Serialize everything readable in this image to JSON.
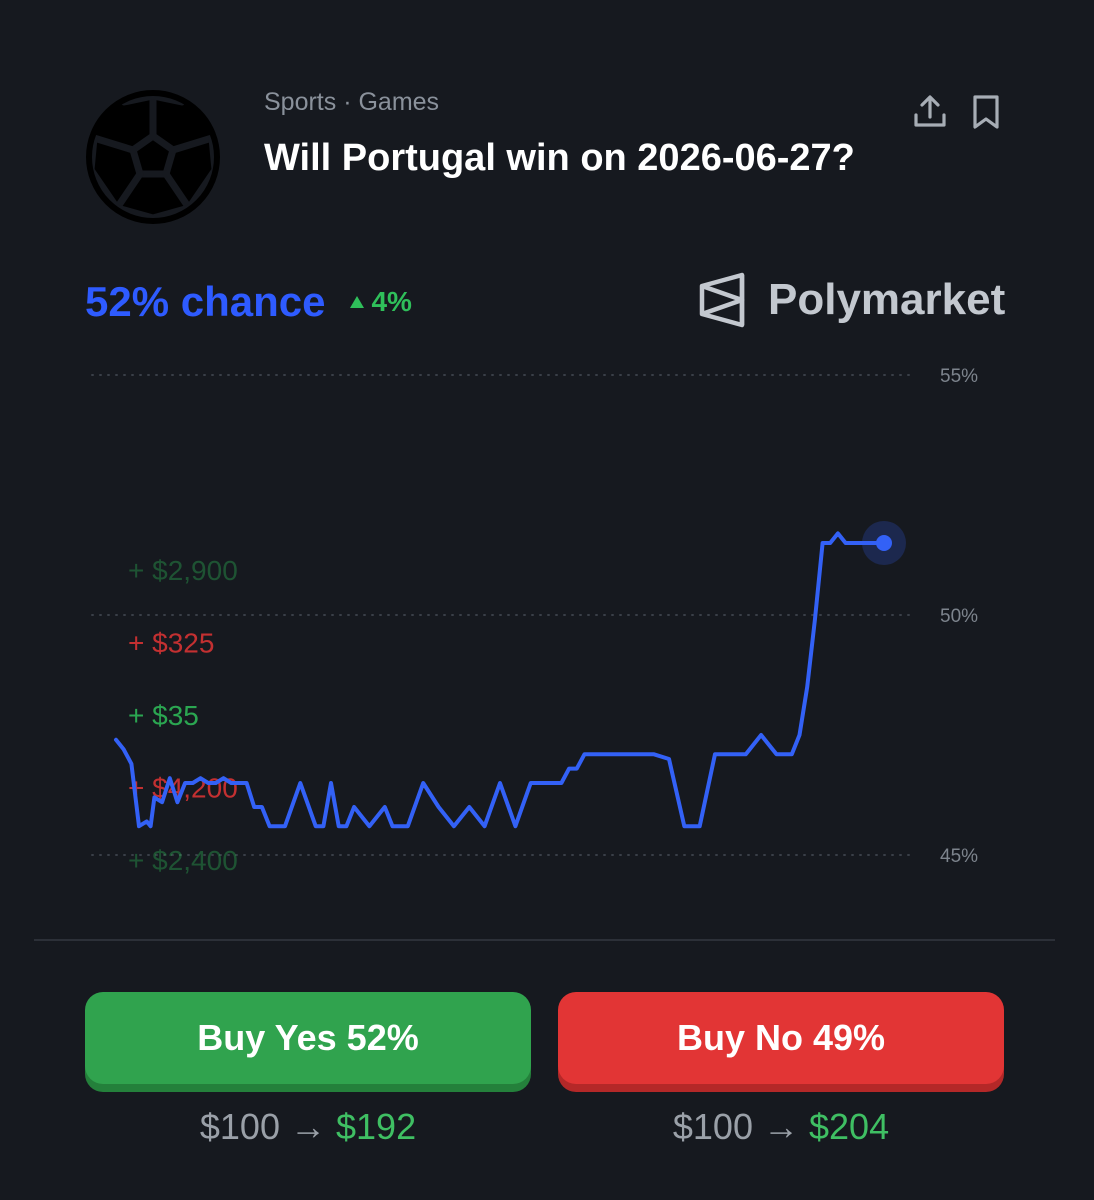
{
  "market": {
    "category": "Sports · Games",
    "question": "Will Portugal win on 2026-06-27?",
    "icon": "soccer-ball-icon",
    "actions": {
      "share_icon": "share-icon",
      "bookmark_icon": "bookmark-icon"
    }
  },
  "odds": {
    "chance_label": "52% chance",
    "change_label": "4%",
    "change_direction": "up",
    "chance_color": "#2e5bff",
    "change_color": "#2fbf5a"
  },
  "brand": {
    "name": "Polymarket",
    "logo": "polymarket-logo-icon"
  },
  "chart_data": {
    "type": "line",
    "series": [
      {
        "color": "#3361f6",
        "x": [
          0,
          1,
          2,
          3,
          4,
          4.5,
          5,
          6,
          7,
          8,
          9,
          10,
          11,
          12,
          13,
          14,
          15,
          16,
          17,
          18,
          19,
          20,
          22,
          24,
          26,
          27,
          28,
          29,
          30,
          31,
          33,
          35,
          36,
          38,
          40,
          42,
          44,
          46,
          48,
          50,
          52,
          54,
          56,
          57,
          58,
          59,
          60,
          61,
          62,
          64,
          66,
          68,
          70,
          72,
          74,
          76,
          78,
          80,
          82,
          84,
          86,
          87,
          88,
          89,
          90,
          91,
          92,
          93,
          94,
          95,
          96,
          97,
          98,
          99,
          100
        ],
        "y": [
          47.4,
          47.2,
          46.9,
          45.6,
          45.7,
          45.6,
          46.2,
          46.1,
          46.6,
          46.1,
          46.5,
          46.5,
          46.6,
          46.5,
          46.5,
          46.6,
          46.5,
          46.5,
          46.5,
          46.0,
          46.0,
          45.6,
          45.6,
          46.5,
          45.6,
          45.6,
          46.5,
          45.6,
          45.6,
          46.0,
          45.6,
          46.0,
          45.6,
          45.6,
          46.5,
          46.0,
          45.6,
          46.0,
          45.6,
          46.5,
          45.6,
          46.5,
          46.5,
          46.5,
          46.5,
          46.8,
          46.8,
          47.1,
          47.1,
          47.1,
          47.1,
          47.1,
          47.1,
          47.0,
          45.6,
          45.6,
          47.1,
          47.1,
          47.1,
          47.5,
          47.1,
          47.1,
          47.1,
          47.5,
          48.5,
          49.9,
          51.5,
          51.5,
          51.7,
          51.5,
          51.5,
          51.5,
          51.5,
          51.5,
          51.5
        ]
      }
    ],
    "y_ticks": [
      "55%",
      "50%",
      "45%"
    ],
    "ylim": [
      44.4,
      56.2
    ],
    "grid": true,
    "grid_style": "dotted",
    "current_value": 51.5,
    "trade_ticker": [
      {
        "text": "+ $2,900",
        "color": "#2fbf5a",
        "opacity": 0.35
      },
      {
        "text": "+ $325",
        "color": "#e23535",
        "opacity": 0.85
      },
      {
        "text": "+ $35",
        "color": "#2fbf5a",
        "opacity": 0.85
      },
      {
        "text": "+ $4,200",
        "color": "#e23535",
        "opacity": 0.85
      },
      {
        "text": "+ $2,400",
        "color": "#2fbf5a",
        "opacity": 0.35
      }
    ]
  },
  "buttons": {
    "yes_label": "Buy Yes 52%",
    "no_label": "Buy No 49%",
    "yes_color": "#30a34e",
    "no_color": "#e23535"
  },
  "payouts": {
    "yes": {
      "from": "$100",
      "arrow": "→",
      "to": "$192"
    },
    "no": {
      "from": "$100",
      "arrow": "→",
      "to": "$204"
    }
  }
}
